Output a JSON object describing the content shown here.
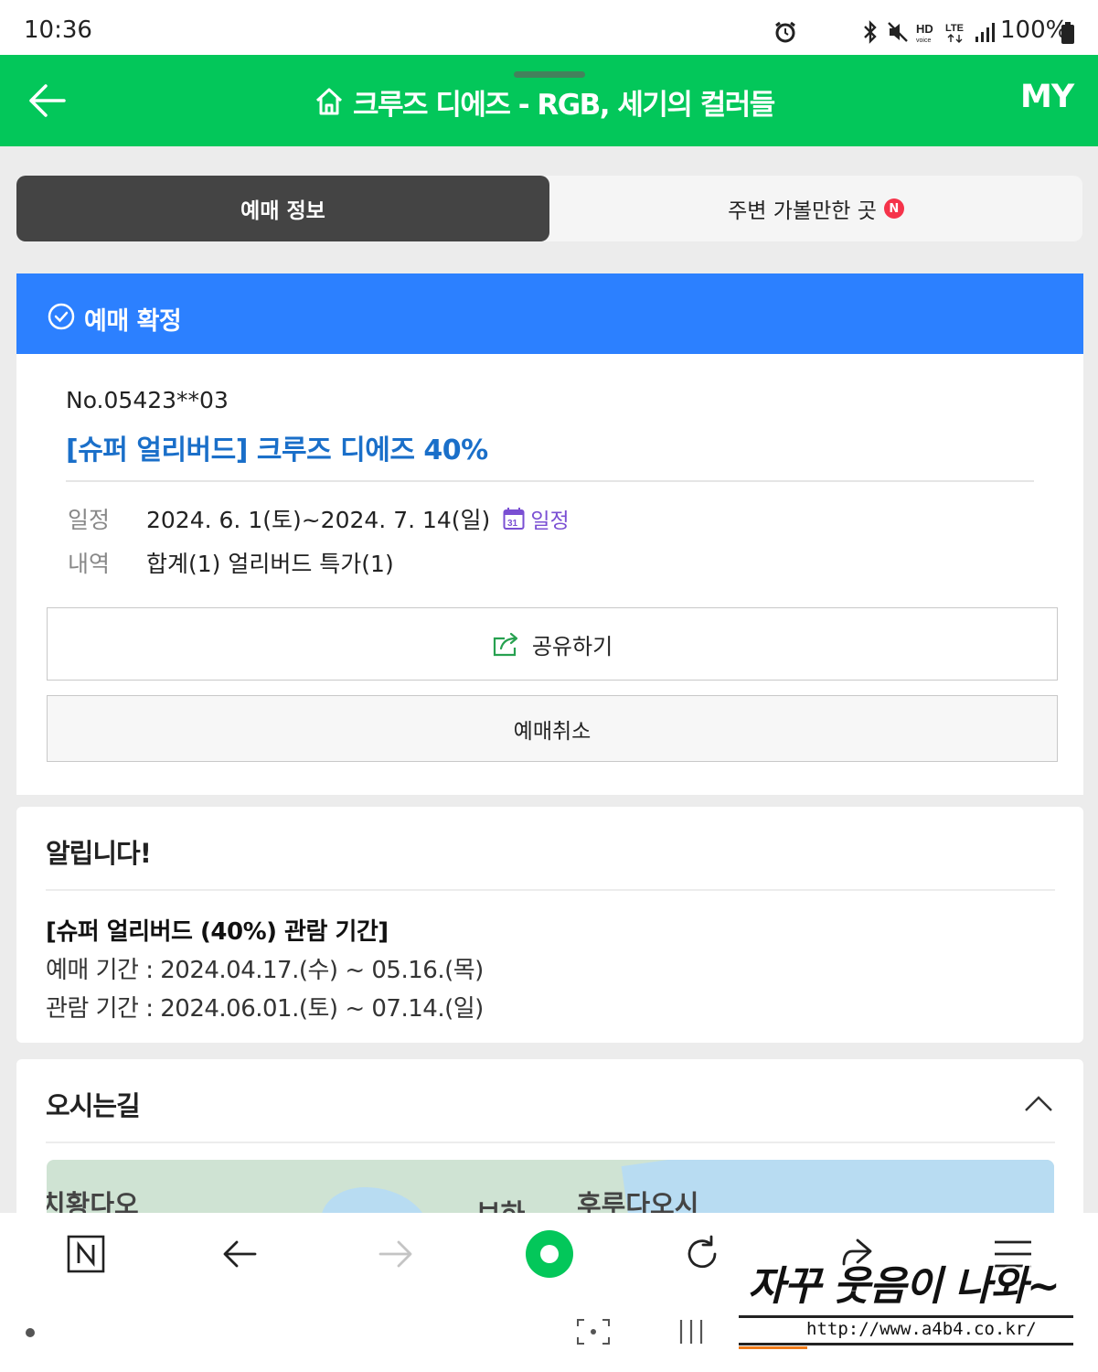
{
  "status_bar": {
    "time": "10:36",
    "network": "HD LTE",
    "battery": "100%",
    "icons": [
      "alarm-icon",
      "bluetooth-icon",
      "mute-icon",
      "hd-voice-icon",
      "lte-icon",
      "signal-icon",
      "battery-icon"
    ]
  },
  "header": {
    "title": "크루즈 디에즈 - RGB, 세기의 컬러들",
    "my_label": "MY",
    "bg_color": "#03c75a"
  },
  "tabs": {
    "active_label": "예매 정보",
    "other_label": "주변 가볼만한 곳",
    "badge": "N"
  },
  "banner": {
    "label": "예매 확정",
    "color": "#2c80ff"
  },
  "booking": {
    "number": "No.05423**03",
    "product": "[슈퍼 얼리버드] 크루즈 디에즈 40%",
    "schedule_key": "일정",
    "schedule_value": "2024. 6. 1(토)~2024. 7. 14(일)",
    "calendar_link": "일정",
    "calendar_day": "31",
    "detail_key": "내역",
    "detail_value": "합계(1) 얼리버드 특가(1)",
    "share_label": "공유하기",
    "cancel_label": "예매취소"
  },
  "notice": {
    "heading": "알립니다!",
    "line1": "[슈퍼 얼리버드 (40%) 관람 기간]",
    "line2": "예매 기간 : 2024.04.17.(수) ~ 05.16.(목)",
    "line3": "관람 기간 : 2024.06.01.(토) ~ 07.14.(일)"
  },
  "directions": {
    "heading": "오시는길",
    "map_labels": [
      "치황다오",
      "보하",
      "후루다오시"
    ]
  },
  "watermark": {
    "text": "자꾸 웃음이 나와~",
    "url": "http://www.a4b4.co.kr/"
  }
}
